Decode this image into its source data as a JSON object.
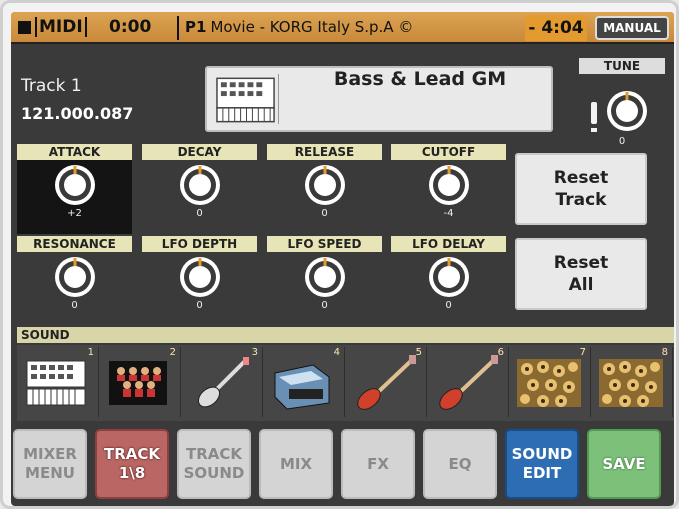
{
  "status": {
    "mode": "MIDI",
    "time": "0:00",
    "performance_tag": "P1",
    "song_title": "Movie - KORG Italy S.p.A ©",
    "remaining": "- 4:04",
    "mode_button": "MANUAL"
  },
  "track": {
    "name": "Track 1",
    "bank_number": "121.000.087",
    "sound_name": "Bass & Lead GM"
  },
  "tune": {
    "label": "TUNE",
    "value": "0"
  },
  "knobs": [
    {
      "label": "ATTACK",
      "value": "+2"
    },
    {
      "label": "DECAY",
      "value": "0"
    },
    {
      "label": "RELEASE",
      "value": "0"
    },
    {
      "label": "CUTOFF",
      "value": "-4"
    },
    {
      "label": "RESONANCE",
      "value": "0"
    },
    {
      "label": "LFO DEPTH",
      "value": "0"
    },
    {
      "label": "LFO SPEED",
      "value": "0"
    },
    {
      "label": "LFO DELAY",
      "value": "0"
    }
  ],
  "buttons": {
    "reset_track_l1": "Reset",
    "reset_track_l2": "Track",
    "reset_all_l1": "Reset",
    "reset_all_l2": "All"
  },
  "sound_section": {
    "label": "SOUND",
    "tracks": [
      {
        "number": "1",
        "icon": "keyboard-icon"
      },
      {
        "number": "2",
        "icon": "choir-icon"
      },
      {
        "number": "3",
        "icon": "electric-guitar-icon"
      },
      {
        "number": "4",
        "icon": "synth-organ-icon"
      },
      {
        "number": "5",
        "icon": "bass-guitar-icon"
      },
      {
        "number": "6",
        "icon": "bass-guitar-icon"
      },
      {
        "number": "7",
        "icon": "drum-texture-icon"
      },
      {
        "number": "8",
        "icon": "drum-texture-icon"
      }
    ]
  },
  "tabs": [
    {
      "l1": "MIXER",
      "l2": "MENU"
    },
    {
      "l1": "TRACK",
      "l2": "1\\8"
    },
    {
      "l1": "TRACK",
      "l2": "SOUND"
    },
    {
      "l1": "MIX",
      "l2": ""
    },
    {
      "l1": "FX",
      "l2": ""
    },
    {
      "l1": "EQ",
      "l2": ""
    },
    {
      "l1": "SOUND",
      "l2": "EDIT"
    },
    {
      "l1": "SAVE",
      "l2": ""
    }
  ],
  "colors": {
    "status_bar": "#dca452",
    "knob_indicator": "#e39a2e",
    "label_bg": "#e7e4b8"
  }
}
